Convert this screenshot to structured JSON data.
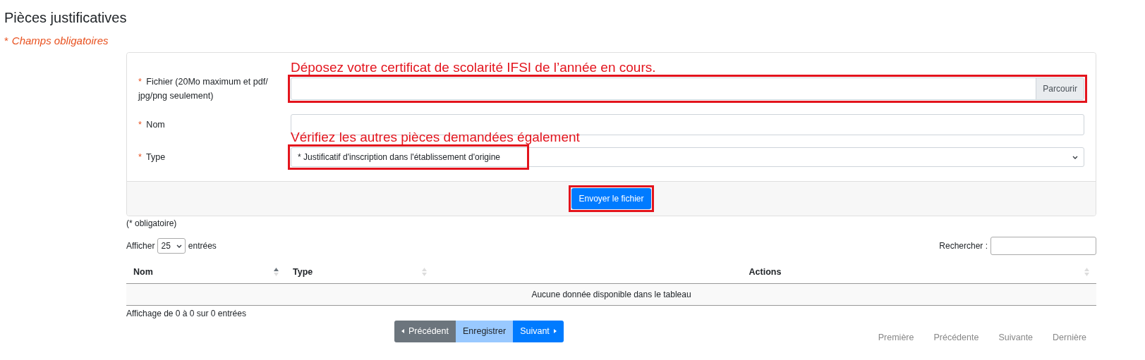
{
  "page": {
    "title": "Pièces justificatives",
    "required_note": {
      "mark": "*",
      "text": "Champs obligatoires"
    }
  },
  "form": {
    "fields": [
      {
        "kind": "file",
        "required_mark": "*",
        "label": "Fichier (20Mo maximum et pdf/ jpg/png seulement)",
        "button": "Parcourir",
        "highlighted": true,
        "annotation": "Déposez votre certificat de scolarité IFSI de l’année en cours."
      },
      {
        "kind": "text",
        "required_mark": "*",
        "label": "Nom",
        "highlighted": false
      },
      {
        "kind": "select",
        "required_mark": "*",
        "label": "Type",
        "value": "* Justificatif d'inscription dans l'établissement d'origine",
        "highlighted": true,
        "annotation": "Vérifiez les autres pièces demandées également"
      }
    ],
    "submit": {
      "label": "Envoyer le fichier",
      "highlighted": true
    }
  },
  "footnote": "(* obligatoire)",
  "length": {
    "before": "Afficher",
    "value": "25",
    "after": "entrées"
  },
  "search": {
    "label": "Rechercher :"
  },
  "table": {
    "columns": [
      {
        "label": "Nom",
        "sorted_ascending": true
      },
      {
        "label": "Type",
        "sorted_ascending": false
      },
      {
        "label": "Actions",
        "sorted_ascending": false
      }
    ],
    "empty": "Aucune donnée disponible dans le tableau"
  },
  "info": "Affichage de 0 à 0 sur 0 entrées",
  "wizard": [
    {
      "kind": "prev",
      "label": "Précédent"
    },
    {
      "kind": "save",
      "label": "Enregistrer"
    },
    {
      "kind": "next",
      "label": "Suivant"
    }
  ],
  "pager": [
    {
      "label": "Première",
      "disabled": true
    },
    {
      "label": "Précédente",
      "disabled": true
    },
    {
      "label": "Suivante",
      "disabled": true
    },
    {
      "label": "Dernière",
      "disabled": true
    }
  ]
}
